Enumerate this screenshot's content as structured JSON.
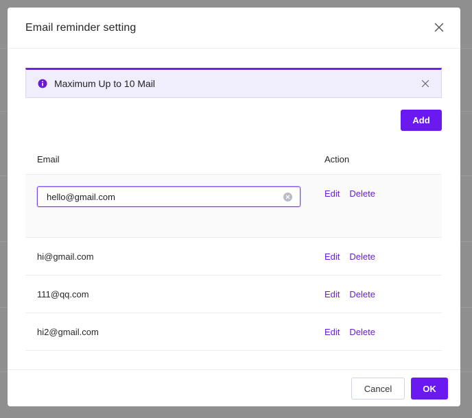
{
  "dialog": {
    "title": "Email reminder setting",
    "close_icon": "close-icon"
  },
  "alert": {
    "icon": "info-icon",
    "text": "Maximum Up to 10 Mail",
    "close_icon": "close-icon"
  },
  "toolbar": {
    "add_label": "Add"
  },
  "table": {
    "headers": {
      "email": "Email",
      "action": "Action"
    },
    "editing_row": {
      "value": "hello@gmail.com",
      "edit_label": "Edit",
      "delete_label": "Delete"
    },
    "rows": [
      {
        "email": "hi@gmail.com",
        "edit_label": "Edit",
        "delete_label": "Delete"
      },
      {
        "email": "111@qq.com",
        "edit_label": "Edit",
        "delete_label": "Delete"
      },
      {
        "email": "hi2@gmail.com",
        "edit_label": "Edit",
        "delete_label": "Delete"
      }
    ]
  },
  "footer": {
    "cancel_label": "Cancel",
    "ok_label": "OK"
  },
  "colors": {
    "accent": "#6a19f0",
    "alert_bg": "#f0eefc",
    "overlay": "#8f8f8f"
  }
}
